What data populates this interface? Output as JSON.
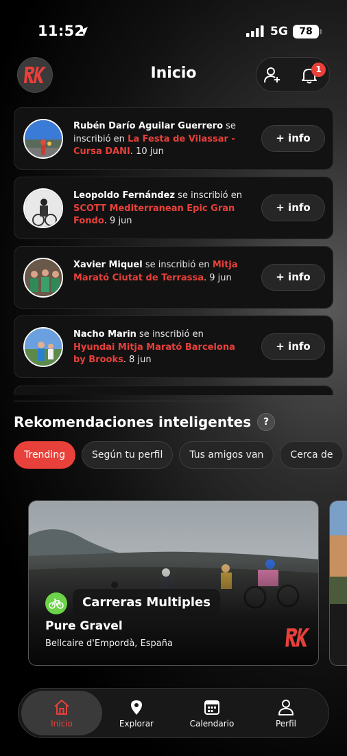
{
  "status_bar": {
    "time": "11:52",
    "network": "5G",
    "battery": "78"
  },
  "header": {
    "title": "Inicio",
    "notification_count": "1"
  },
  "feed": [
    {
      "user": "Rubén Darío Aguilar Guerrero",
      "action": " se inscribió en ",
      "event": "La Festa de Vilassar - Cursa DANI",
      "date": ". 10 jun",
      "button": "+ info"
    },
    {
      "user": "Leopoldo Fernández",
      "action": " se inscribió en ",
      "event": "SCOTT Mediterranean Epic Gran Fondo",
      "date": ". 9 jun",
      "button": "+ info"
    },
    {
      "user": "Xavier Miquel",
      "action": " se inscribió en ",
      "event": "Mitja Marató Ciutat de Terrassa",
      "date": ". 9 jun",
      "button": "+ info"
    },
    {
      "user": "Nacho Marin",
      "action": " se inscribió en ",
      "event": "Hyundai Mitja Marató Barcelona by Brooks",
      "date": ". 8 jun",
      "button": "+ info"
    }
  ],
  "recommendations": {
    "title": "Rekomendaciones inteligentes",
    "help": "?",
    "chips": [
      "Trending",
      "Según tu perfil",
      "Tus amigos van",
      "Cerca de"
    ],
    "active_chip": "Trending",
    "event": {
      "category": "Carreras Multiples",
      "name": "Pure Gravel",
      "location": "Bellcaire d'Empordà, España"
    }
  },
  "nav": {
    "items": [
      {
        "label": "Inicio",
        "icon": "home-icon"
      },
      {
        "label": "Explorar",
        "icon": "map-pin-icon"
      },
      {
        "label": "Calendario",
        "icon": "calendar-icon"
      },
      {
        "label": "Perfil",
        "icon": "profile-icon"
      }
    ],
    "active": "Inicio"
  },
  "colors": {
    "accent": "#e8403a",
    "category_green": "#6cd34a",
    "card_bg": "#121212"
  }
}
